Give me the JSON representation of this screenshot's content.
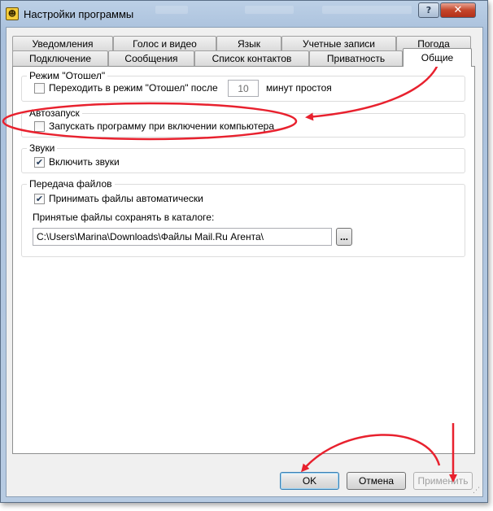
{
  "window": {
    "title": "Настройки программы",
    "app_icon_glyph": "☻",
    "help_button": "?",
    "close_button": "✕"
  },
  "tabs_row_back": [
    "Уведомления",
    "Голос и видео",
    "Язык",
    "Учетные записи",
    "Погода"
  ],
  "tabs_row_front": [
    "Подключение",
    "Сообщения",
    "Список контактов",
    "Приватность",
    "Общие"
  ],
  "active_tab": "Общие",
  "groups": {
    "away": {
      "title": "Режим \"Отошел\"",
      "checkbox_label": "Переходить в режим \"Отошел\" после",
      "checked": false,
      "minutes_value": "10",
      "minutes_suffix": "минут простоя"
    },
    "autostart": {
      "title": "Автозапуск",
      "checkbox_label": "Запускать программу при включении компьютера",
      "checked": false
    },
    "sounds": {
      "title": "Звуки",
      "checkbox_label": "Включить звуки",
      "checked": true
    },
    "files": {
      "title": "Передача файлов",
      "checkbox_label": "Принимать файлы автоматически",
      "checked": true,
      "folder_label": "Принятые файлы сохранять в каталоге:",
      "folder_path": "C:\\Users\\Marina\\Downloads\\Файлы Mail.Ru Агента\\",
      "browse_button": "..."
    }
  },
  "buttons": {
    "ok": "OK",
    "cancel": "Отмена",
    "apply": "Применить"
  },
  "icons": {
    "check_glyph": "✔",
    "grip_glyph": "⋰"
  },
  "annotation_color": "#e8212e"
}
